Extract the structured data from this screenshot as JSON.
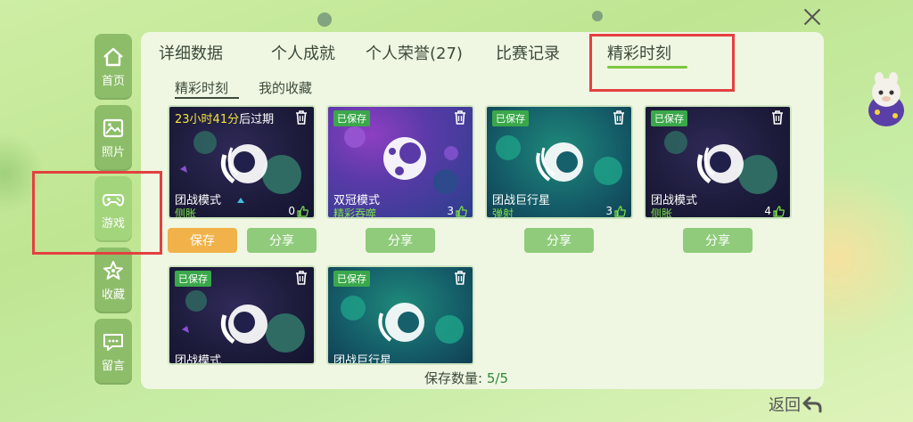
{
  "sidebar": {
    "items": [
      {
        "label": "首页",
        "icon": "home-icon"
      },
      {
        "label": "照片",
        "icon": "photo-icon"
      },
      {
        "label": "游戏",
        "icon": "gamepad-icon",
        "active": true
      },
      {
        "label": "收藏",
        "icon": "star-icon"
      },
      {
        "label": "留言",
        "icon": "message-icon"
      }
    ]
  },
  "tabs": [
    {
      "label": "详细数据"
    },
    {
      "label": "个人成就"
    },
    {
      "label": "个人荣誉(27)"
    },
    {
      "label": "比赛记录"
    },
    {
      "label": "精彩时刻",
      "active": true
    }
  ],
  "subtabs": [
    {
      "label": "精彩时刻",
      "active": true
    },
    {
      "label": "我的收藏"
    }
  ],
  "cards": [
    {
      "expire_time": "23小时41分",
      "expire_suffix": "后过期",
      "mode": "团战模式",
      "sub": "侧胀",
      "likes": "0",
      "theme": "purple"
    },
    {
      "badge": "已保存",
      "mode": "双冠模式",
      "sub": "精彩吞噬",
      "likes": "3",
      "theme": "violet"
    },
    {
      "badge": "已保存",
      "mode": "团战巨行星",
      "sub": "弹射",
      "likes": "3",
      "theme": "teal"
    },
    {
      "badge": "已保存",
      "mode": "团战模式",
      "sub": "侧胀",
      "likes": "4",
      "theme": "purple"
    },
    {
      "badge": "已保存",
      "mode": "团战模式",
      "theme": "purple"
    },
    {
      "badge": "已保存",
      "mode": "团战巨行星",
      "theme": "teal"
    }
  ],
  "buttons": {
    "save": "保存",
    "share": "分享"
  },
  "save_count": {
    "label": "保存数量:",
    "value": "5/5"
  },
  "back": {
    "label": "返回"
  },
  "colors": {
    "accent_green": "#7dc63f",
    "highlight_red": "#e44040",
    "save_orange": "#f2b24a"
  }
}
